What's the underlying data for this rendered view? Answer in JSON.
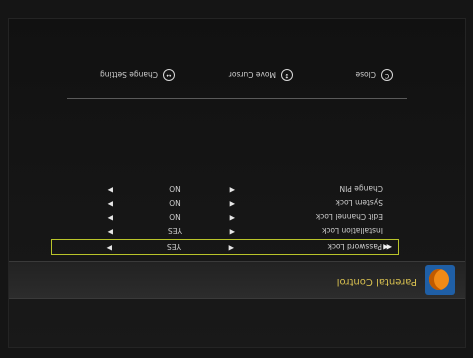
{
  "app": {
    "title": "Parental Control"
  },
  "rows": [
    {
      "label": "Password Lock",
      "value": "YES",
      "selected": true
    },
    {
      "label": "Installation Lock",
      "value": "YES",
      "selected": false
    },
    {
      "label": "Edit Channel Lock",
      "value": "NO",
      "selected": false
    },
    {
      "label": "System Lock",
      "value": "NO",
      "selected": false
    },
    {
      "label": "Change PIN",
      "value": "NO",
      "selected": false
    }
  ],
  "footer": {
    "close": {
      "key": "C",
      "label": "Close"
    },
    "move": {
      "key": "↕",
      "label": "Move Cursor"
    },
    "change": {
      "key": "↔",
      "label": "Change Setting"
    }
  },
  "colors": {
    "highlight": "#b9c42a",
    "title": "#d8c050",
    "icon_bg": "#1f5fa6",
    "icon_fg": "#f08a17"
  }
}
